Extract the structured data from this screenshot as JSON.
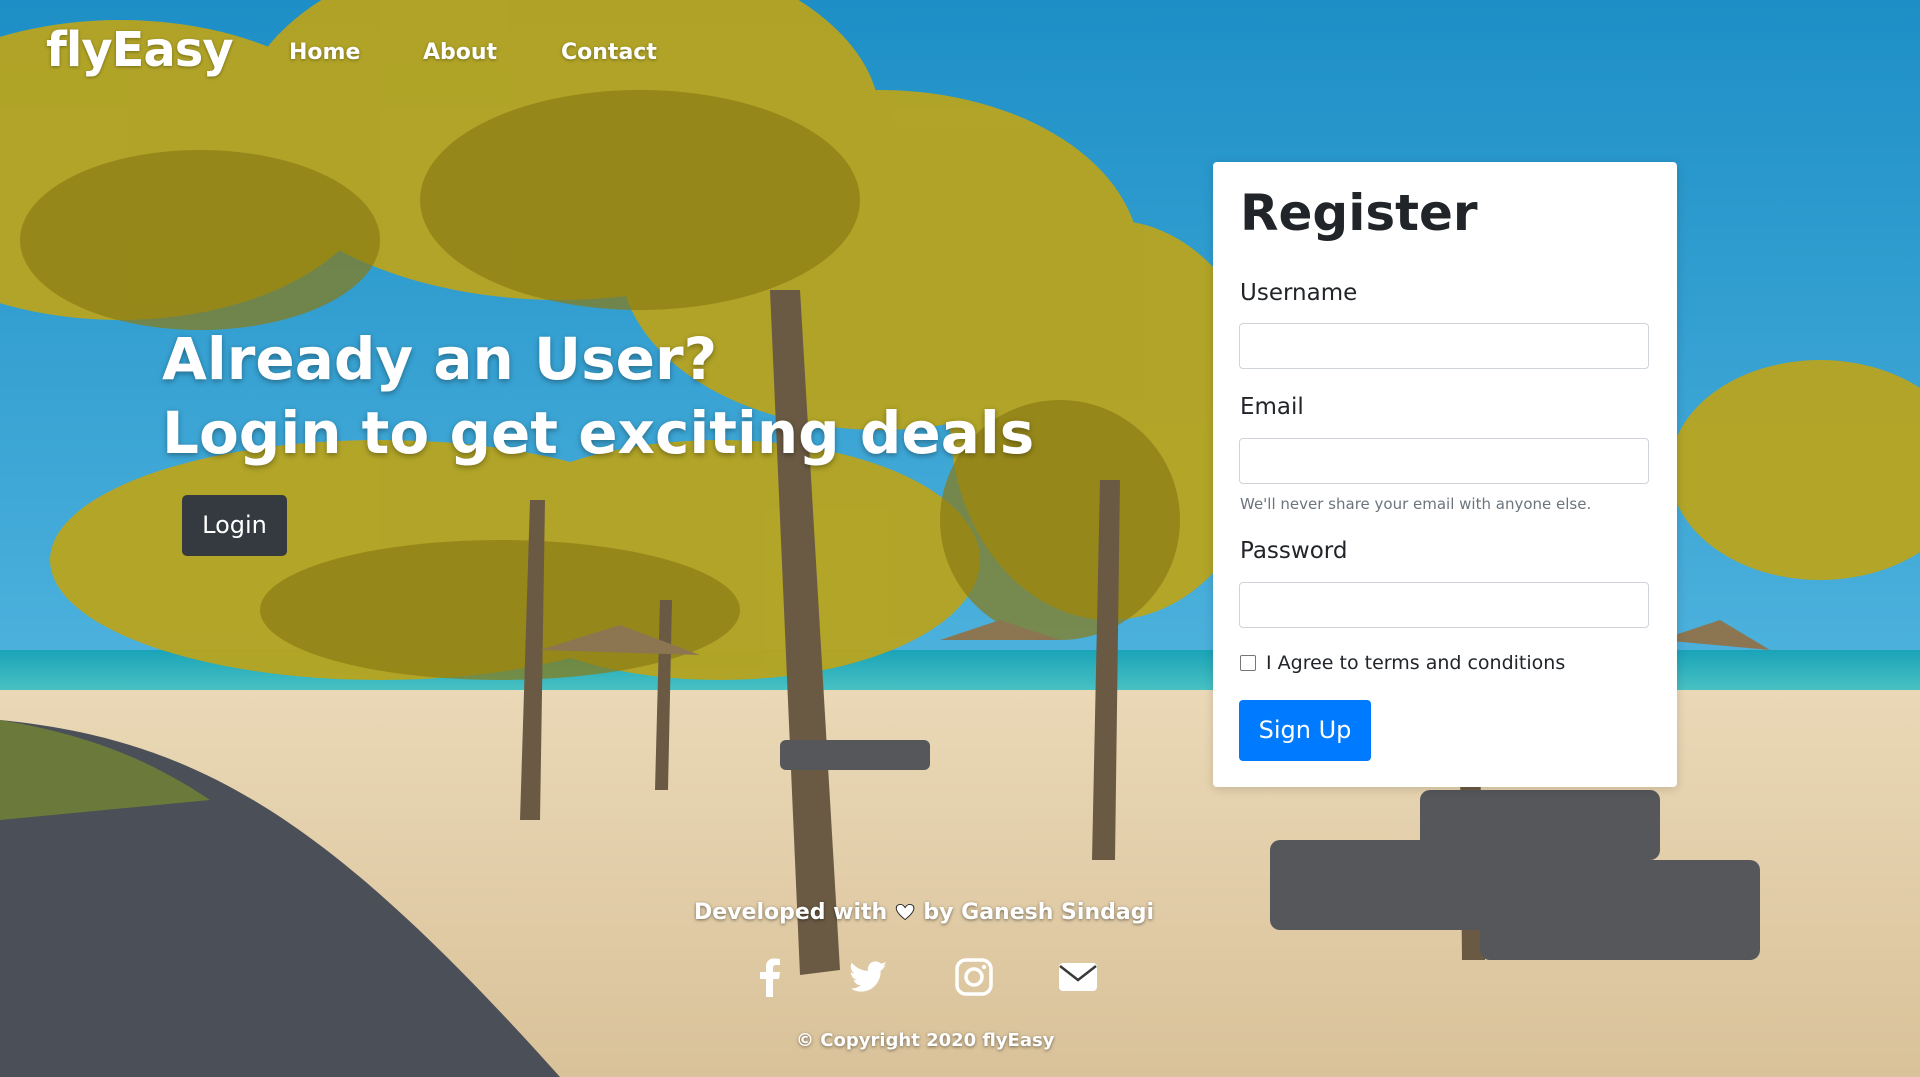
{
  "brand": "flyEasy",
  "nav": {
    "items": [
      {
        "label": "Home"
      },
      {
        "label": "About"
      },
      {
        "label": "Contact"
      }
    ]
  },
  "hero": {
    "line1": "Already an User?",
    "line2": "Login to get exciting deals",
    "login_label": "Login"
  },
  "register": {
    "title": "Register",
    "username_label": "Username",
    "username_value": "",
    "email_label": "Email",
    "email_value": "",
    "email_help": "We'll never share your email with anyone else.",
    "password_label": "Password",
    "password_value": "",
    "agree_label": "I Agree to terms and conditions",
    "agree_checked": false,
    "signup_label": "Sign Up"
  },
  "footer": {
    "developed_prefix": "Developed with",
    "developed_suffix": "by Ganesh Sindagi",
    "heart_icon": "heart-icon",
    "social_icons": [
      "facebook-icon",
      "twitter-icon",
      "instagram-icon",
      "envelope-icon"
    ],
    "copyright": "© Copyright 2020 flyEasy"
  },
  "colors": {
    "primary": "#007bff",
    "dark_button": "#343a40",
    "text_white": "#ffffff"
  }
}
